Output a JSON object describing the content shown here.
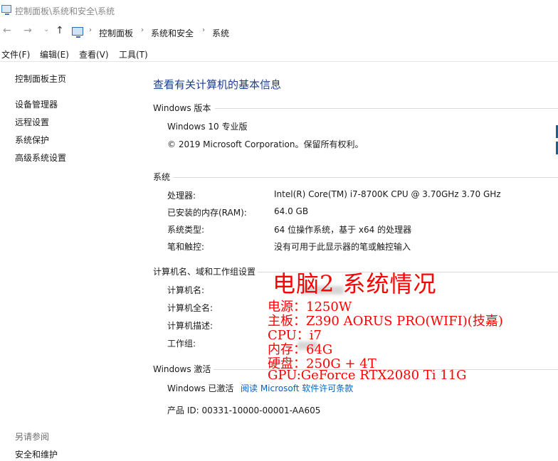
{
  "window": {
    "title": "控制面板\\系统和安全\\系统"
  },
  "nav": {
    "back_glyph": "←",
    "forward_glyph": "→",
    "dropdown_glyph": "⌄",
    "up_glyph": "↑",
    "breadcrumb": [
      "控制面板",
      "系统和安全",
      "系统"
    ],
    "separator": "›"
  },
  "menu": [
    "文件(F)",
    "编辑(E)",
    "查看(V)",
    "工具(T)"
  ],
  "sidebar": {
    "home": "控制面板主页",
    "items": [
      "设备管理器",
      "远程设置",
      "系统保护",
      "高级系统设置"
    ],
    "see_also_title": "另请参阅",
    "see_also_items": [
      "安全和维护"
    ]
  },
  "main": {
    "title": "查看有关计算机的基本信息",
    "edition": {
      "heading": "Windows 版本",
      "name": "Windows 10 专业版",
      "copyright": "© 2019 Microsoft Corporation。保留所有权利。"
    },
    "system": {
      "heading": "系统",
      "rows": [
        {
          "label": "处理器:",
          "value": "Intel(R) Core(TM) i7-8700K CPU @ 3.70GHz   3.70 GHz"
        },
        {
          "label": "已安装的内存(RAM):",
          "value": "64.0 GB"
        },
        {
          "label": "系统类型:",
          "value": "64 位操作系统，基于 x64 的处理器"
        },
        {
          "label": "笔和触控:",
          "value": "没有可用于此显示器的笔或触控输入"
        }
      ]
    },
    "computer": {
      "heading": "计算机名、域和工作组设置",
      "rows": [
        "计算机名:",
        "计算机全名:",
        "计算机描述:",
        "工作组:"
      ]
    },
    "activation": {
      "heading": "Windows 激活",
      "status": "Windows 已激活",
      "license_link": "阅读 Microsoft 软件许可条款",
      "product_id": "产品 ID: 00331-10000-00001-AA605"
    }
  },
  "overlay": {
    "title": "电脑2 系统情况",
    "lines": [
      "电源：1250W",
      "主板：Z390 AORUS PRO(WIFI)(技嘉)",
      "CPU：i7",
      "内存：64G",
      "硬盘：250G + 4T",
      "GPU:GeForce RTX2080 Ti 11G"
    ]
  },
  "colors": {
    "title_blue": "#1e3d8c",
    "link_blue": "#0563c1",
    "overlay_red": "#ff0000"
  }
}
